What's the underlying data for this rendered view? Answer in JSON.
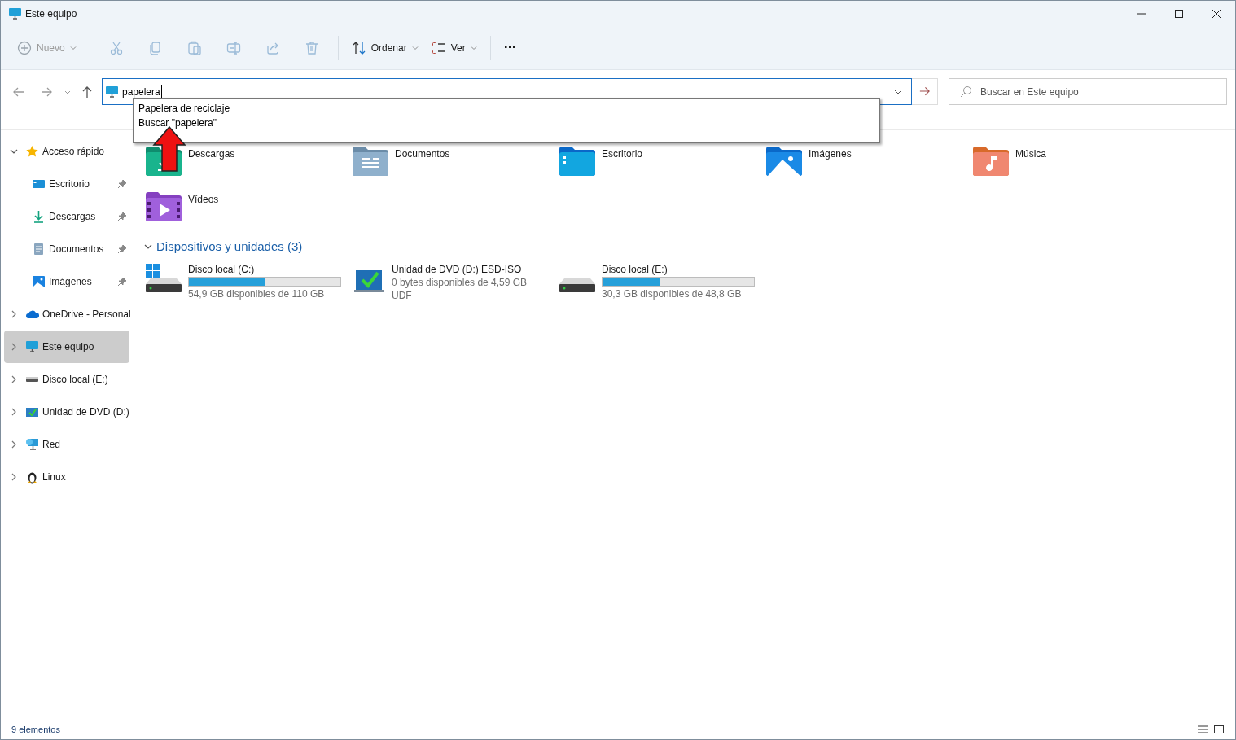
{
  "window": {
    "title": "Este equipo"
  },
  "toolbar": [
    {
      "kind": "new",
      "label": "Nuevo",
      "disabled": true
    },
    {
      "kind": "cut",
      "disabled": true
    },
    {
      "kind": "copy",
      "disabled": true
    },
    {
      "kind": "paste",
      "disabled": true
    },
    {
      "kind": "rename",
      "disabled": true
    },
    {
      "kind": "share",
      "disabled": true
    },
    {
      "kind": "delete",
      "disabled": true
    },
    {
      "kind": "sort",
      "label": "Ordenar",
      "disabled": false
    },
    {
      "kind": "view",
      "label": "Ver",
      "disabled": false
    },
    {
      "kind": "more",
      "label": "···",
      "disabled": false
    }
  ],
  "address": {
    "value": "papelera",
    "suggestions": [
      "Papelera de reciclaje",
      "Buscar \"papelera\""
    ]
  },
  "search": {
    "placeholder": "Buscar en Este equipo"
  },
  "sidebar": [
    {
      "label": "Acceso rápido",
      "kind": "star",
      "expanded": true,
      "selected": false,
      "children": [
        {
          "label": "Escritorio",
          "kind": "desktop",
          "pinned": true,
          "selected": false
        },
        {
          "label": "Descargas",
          "kind": "download",
          "pinned": true,
          "selected": false
        },
        {
          "label": "Documentos",
          "kind": "document",
          "pinned": true,
          "selected": false
        },
        {
          "label": "Imágenes",
          "kind": "image",
          "pinned": true,
          "selected": false
        }
      ]
    },
    {
      "label": "OneDrive - Personal",
      "kind": "cloud",
      "expanded": false,
      "selected": false
    },
    {
      "label": "Este equipo",
      "kind": "pc",
      "expanded": false,
      "selected": true
    },
    {
      "label": "Disco local (E:)",
      "kind": "drive",
      "expanded": false,
      "selected": false
    },
    {
      "label": "Unidad de DVD (D:)",
      "kind": "dvd",
      "expanded": false,
      "selected": false
    },
    {
      "label": "Red",
      "kind": "network",
      "expanded": false,
      "selected": false
    },
    {
      "label": "Linux",
      "kind": "linux",
      "expanded": false,
      "selected": false
    }
  ],
  "folders": [
    {
      "label": "Descargas",
      "kind": "download"
    },
    {
      "label": "Documentos",
      "kind": "document"
    },
    {
      "label": "Escritorio",
      "kind": "desktop"
    },
    {
      "label": "Imágenes",
      "kind": "image"
    },
    {
      "label": "Música",
      "kind": "music"
    },
    {
      "label": "Vídeos",
      "kind": "video"
    }
  ],
  "devices": {
    "title": "Dispositivos y unidades (3)",
    "expanded": true,
    "items": [
      {
        "label": "Disco local (C:)",
        "kind": "system",
        "level": 0.5,
        "details": [
          "54,9 GB disponibles de 110 GB"
        ]
      },
      {
        "label": "Unidad de DVD (D:) ESD-ISO",
        "kind": "dvd",
        "details": [
          "0 bytes disponibles de 4,59 GB",
          "UDF"
        ]
      },
      {
        "label": "Disco local (E:)",
        "kind": "drive",
        "level": 0.38,
        "details": [
          "30,3 GB disponibles de 48,8 GB"
        ]
      }
    ]
  },
  "status_bar": {
    "count": "9 elementos"
  }
}
